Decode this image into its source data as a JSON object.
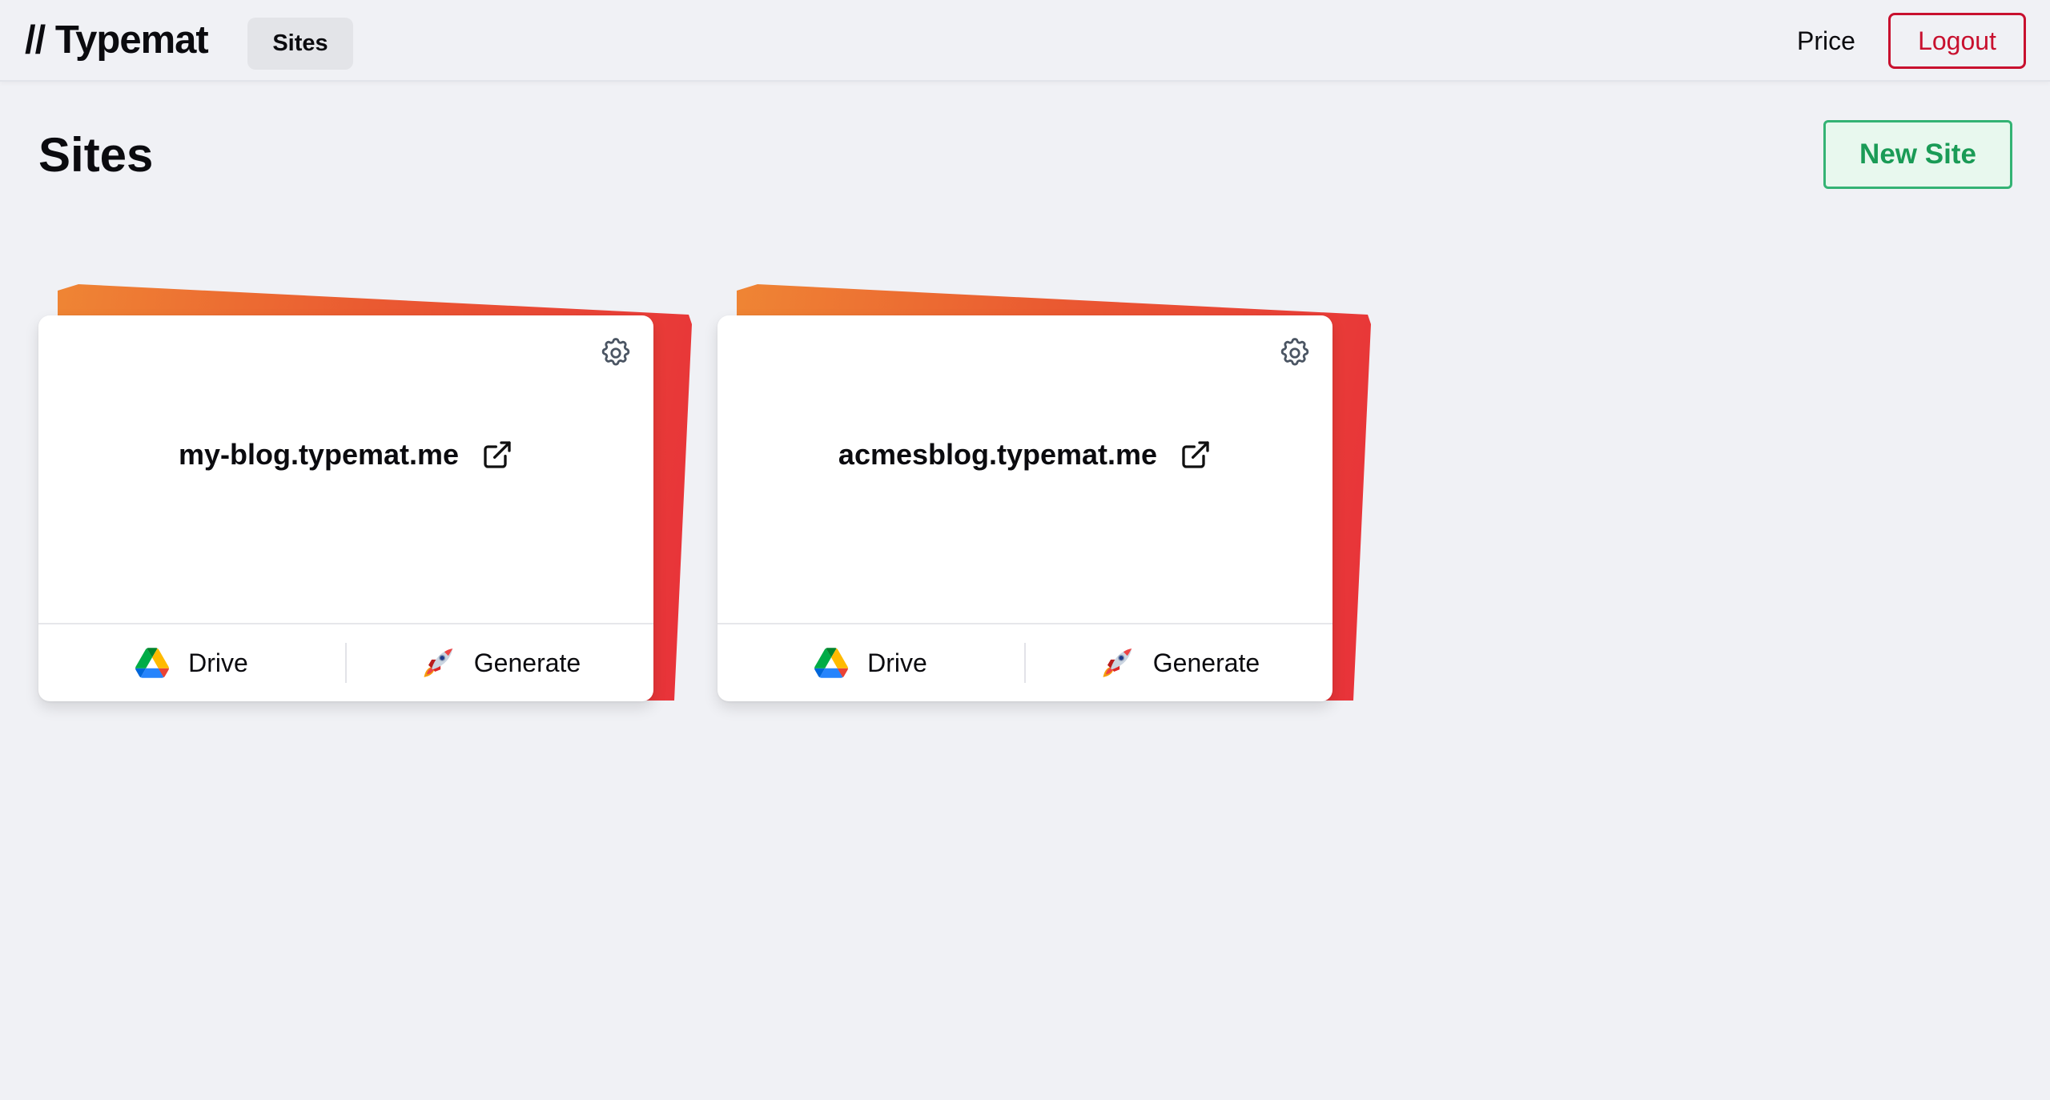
{
  "header": {
    "logo": "// Typemat",
    "nav_sites": "Sites",
    "nav_price": "Price",
    "logout": "Logout"
  },
  "page": {
    "title": "Sites",
    "new_site": "New Site"
  },
  "sites": [
    {
      "name": "my-blog.typemat.me",
      "drive": "Drive",
      "generate": "Generate"
    },
    {
      "name": "acmesblog.typemat.me",
      "drive": "Drive",
      "generate": "Generate"
    }
  ],
  "colors": {
    "accent_red": "#c8102e",
    "accent_green": "#1a9b56",
    "card_gradient_start": "#ef8534",
    "card_gradient_end": "#e8313a",
    "background": "#f0f1f5"
  },
  "icons": {
    "settings": "gear-icon",
    "open_external": "external-link-icon",
    "drive": "google-drive-icon",
    "generate": "rocket-icon"
  }
}
